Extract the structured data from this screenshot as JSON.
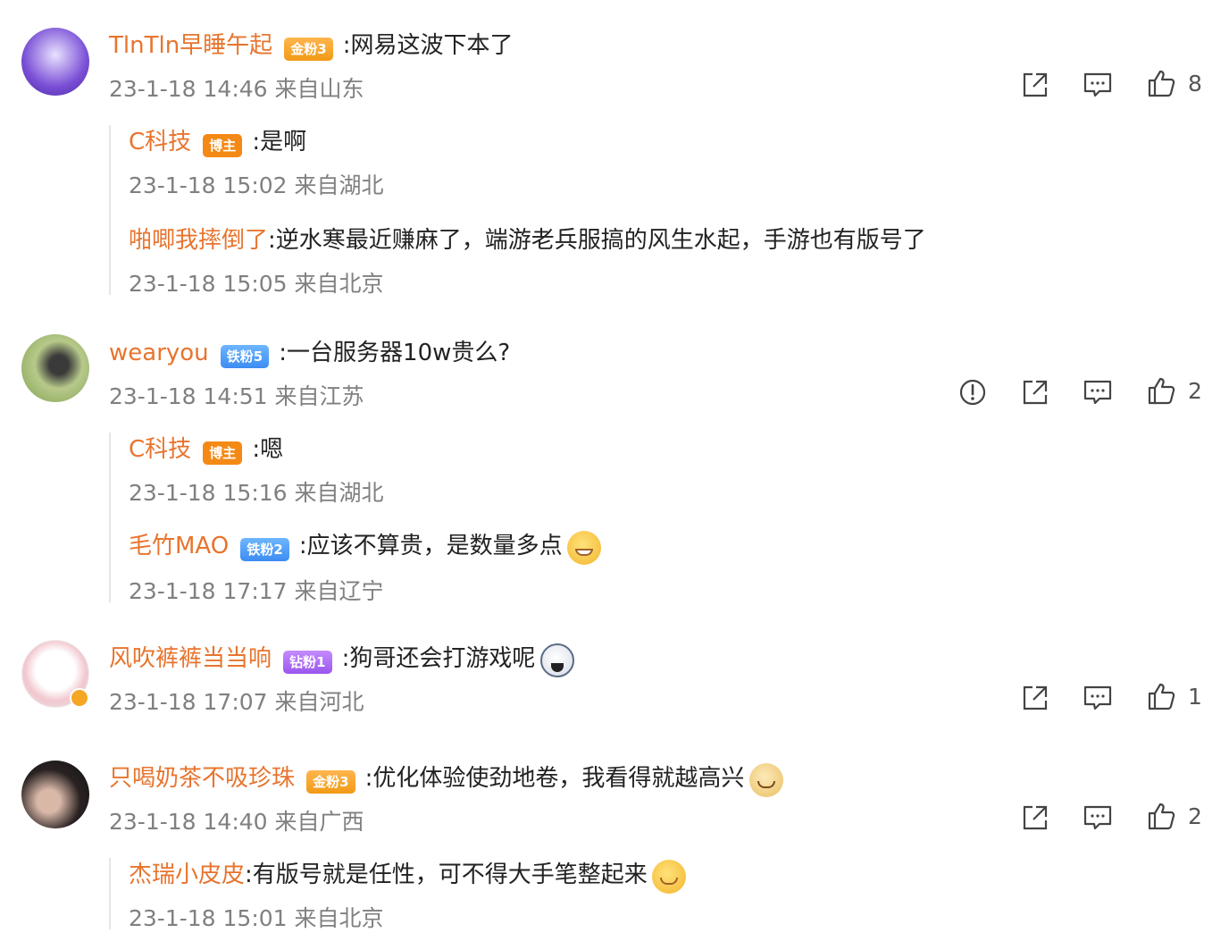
{
  "comments": [
    {
      "user": "TlnTln早睡午起",
      "badge": "金粉3",
      "text": ":网易这波下本了",
      "meta": "23-1-18 14:46 来自山东",
      "likes": "8",
      "replies": [
        {
          "user": "C科技",
          "badge": "博主",
          "text": ":是啊",
          "meta": "23-1-18 15:02 来自湖北"
        },
        {
          "user": "啪唧我摔倒了",
          "text": ":逆水寒最近赚麻了，端游老兵服搞的风生水起，手游也有版号了",
          "meta": "23-1-18 15:05 来自北京"
        }
      ]
    },
    {
      "user": "wearyou",
      "badge": "铁粉5",
      "text": ":一台服务器10w贵么?",
      "meta": "23-1-18 14:51 来自江苏",
      "likes": "2",
      "replies": [
        {
          "user": "C科技",
          "badge": "博主",
          "text": ":嗯",
          "meta": "23-1-18 15:16 来自湖北"
        },
        {
          "user": "毛竹MAO",
          "badge": "铁粉2",
          "text": ":应该不算贵，是数量多点",
          "meta": "23-1-18 17:17 来自辽宁"
        }
      ]
    },
    {
      "user": "风吹裤裤当当响",
      "badge": "钻粉1",
      "text": ":狗哥还会打游戏呢",
      "meta": "23-1-18 17:07 来自河北",
      "likes": "1"
    },
    {
      "user": "只喝奶茶不吸珍珠",
      "badge": "金粉3",
      "text": ":优化体验使劲地卷，我看得就越高兴",
      "meta": "23-1-18 14:40 来自广西",
      "likes": "2",
      "replies": [
        {
          "user": "杰瑞小皮皮",
          "text": ":有版号就是任性，可不得大手笔整起来",
          "meta": "23-1-18 15:01 来自北京"
        }
      ]
    }
  ],
  "icons": {
    "share": "share-icon",
    "comment": "comment-icon",
    "like": "thumbs-up-icon",
    "report": "report-icon"
  },
  "colors": {
    "username": "#e8742e",
    "meta": "#808080",
    "badge_gold": "#f29a16",
    "badge_blue": "#3d8cf2"
  }
}
